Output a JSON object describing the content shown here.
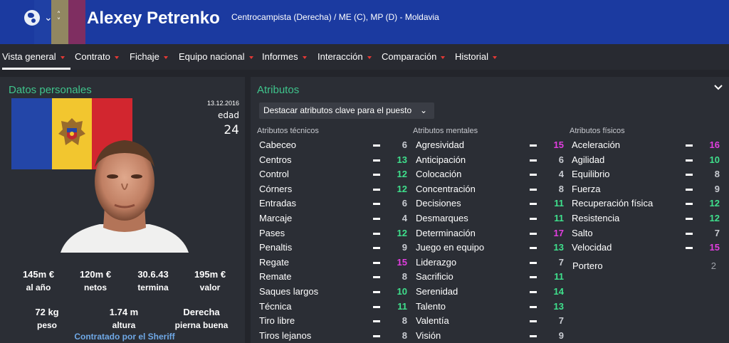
{
  "header": {
    "player_name": "Alexey Petrenko",
    "subtitle": "Centrocampista (Derecha) / ME (C), MP (D) - Moldavia",
    "bg_color": "#1b3aa0"
  },
  "nav": {
    "items": [
      {
        "label": "Vista general",
        "active": true
      },
      {
        "label": "Contrato"
      },
      {
        "label": "Fichaje"
      },
      {
        "label": "Equipo nacional"
      },
      {
        "label": "Informes"
      },
      {
        "label": "Interacción"
      },
      {
        "label": "Comparación"
      },
      {
        "label": "Historial"
      }
    ]
  },
  "personal": {
    "title": "Datos personales",
    "date": "13.12.2016",
    "age_label": "edad",
    "age_value": "24",
    "stats": [
      {
        "value": "145m €",
        "label": "al año"
      },
      {
        "value": "120m €",
        "label": "netos"
      },
      {
        "value": "30.6.43",
        "label": "termina"
      },
      {
        "value": "195m €",
        "label": "valor"
      }
    ],
    "stats2": [
      {
        "value": "72 kg",
        "label": "peso"
      },
      {
        "value": "1.74 m",
        "label": "altura"
      },
      {
        "value": "Derecha",
        "label": "pierna buena"
      }
    ],
    "contract": "Contratado por el Sheriff",
    "flag_colors": [
      "#2346a8",
      "#f2c62f",
      "#d2262f"
    ]
  },
  "attributes": {
    "title": "Atributos",
    "highlight_button": "Destacar atributos clave para el puesto",
    "technical_title": "Atributos técnicos",
    "mental_title": "Atributos mentales",
    "physical_title": "Atributos físicos",
    "technical": [
      {
        "name": "Cabeceo",
        "value": "6"
      },
      {
        "name": "Centros",
        "value": "13"
      },
      {
        "name": "Control",
        "value": "12"
      },
      {
        "name": "Córners",
        "value": "12"
      },
      {
        "name": "Entradas",
        "value": "6"
      },
      {
        "name": "Marcaje",
        "value": "4"
      },
      {
        "name": "Pases",
        "value": "12"
      },
      {
        "name": "Penaltis",
        "value": "9"
      },
      {
        "name": "Regate",
        "value": "15"
      },
      {
        "name": "Remate",
        "value": "8"
      },
      {
        "name": "Saques largos",
        "value": "10"
      },
      {
        "name": "Técnica",
        "value": "11"
      },
      {
        "name": "Tiro libre",
        "value": "8"
      },
      {
        "name": "Tiros lejanos",
        "value": "8"
      }
    ],
    "mental": [
      {
        "name": "Agresividad",
        "value": "15"
      },
      {
        "name": "Anticipación",
        "value": "6"
      },
      {
        "name": "Colocación",
        "value": "4"
      },
      {
        "name": "Concentración",
        "value": "8"
      },
      {
        "name": "Decisiones",
        "value": "11"
      },
      {
        "name": "Desmarques",
        "value": "11"
      },
      {
        "name": "Determinación",
        "value": "17"
      },
      {
        "name": "Juego en equipo",
        "value": "13"
      },
      {
        "name": "Liderazgo",
        "value": "7"
      },
      {
        "name": "Sacrificio",
        "value": "11"
      },
      {
        "name": "Serenidad",
        "value": "14"
      },
      {
        "name": "Talento",
        "value": "13"
      },
      {
        "name": "Valentía",
        "value": "7"
      },
      {
        "name": "Visión",
        "value": "9"
      }
    ],
    "physical": [
      {
        "name": "Aceleración",
        "value": "16"
      },
      {
        "name": "Agilidad",
        "value": "10"
      },
      {
        "name": "Equilibrio",
        "value": "8"
      },
      {
        "name": "Fuerza",
        "value": "9"
      },
      {
        "name": "Recuperación física",
        "value": "12"
      },
      {
        "name": "Resistencia",
        "value": "12"
      },
      {
        "name": "Salto",
        "value": "7"
      },
      {
        "name": "Velocidad",
        "value": "15"
      }
    ],
    "goalkeeper_label": "Portero",
    "goalkeeper_value": "2"
  }
}
